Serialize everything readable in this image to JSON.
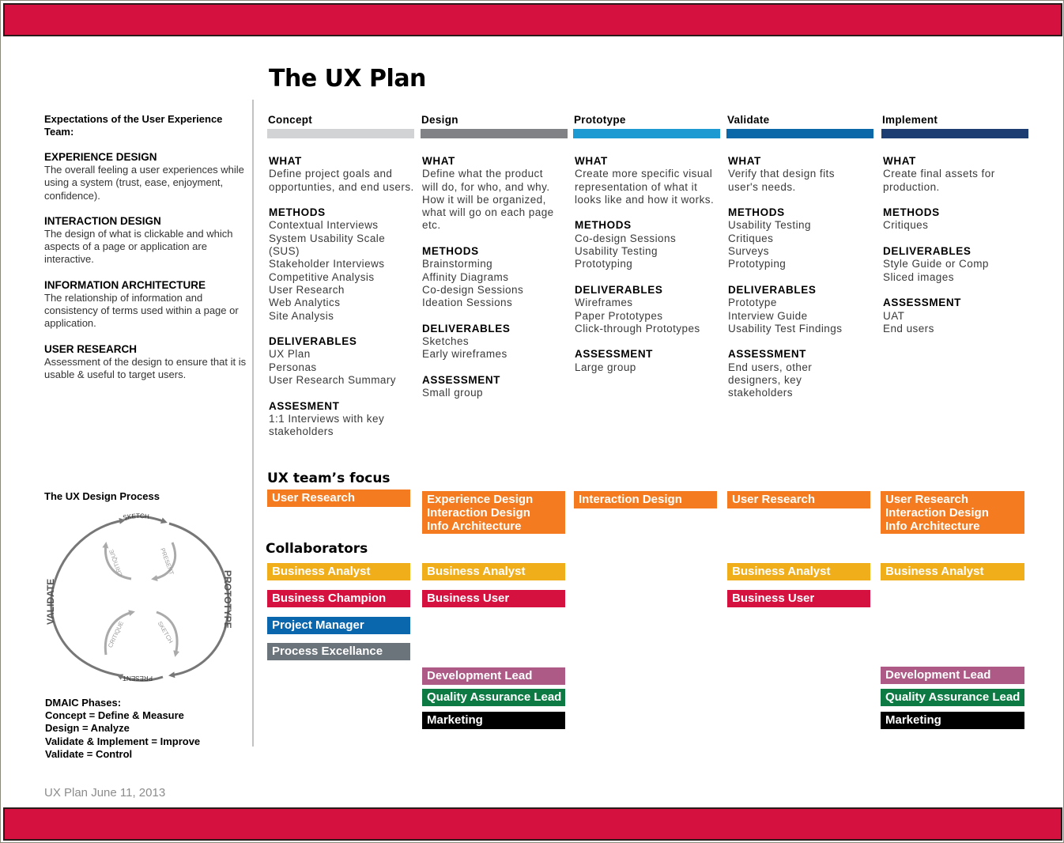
{
  "document": {
    "title": "The UX Plan",
    "footer_note": "UX Plan  June 11, 2013"
  },
  "colors": {
    "band": "#d4113f",
    "focus_orange": "#f47b20",
    "business_analyst": "#f0ae1b",
    "business_red": "#d4113f",
    "project_manager": "#0a66ad",
    "process_gray": "#6b737b",
    "development_lead": "#ad5a87",
    "qa_green": "#0d7a44",
    "marketing": "#000000"
  },
  "left": {
    "intro": "Expectations of the User Experience Team:",
    "definitions": [
      {
        "heading": "EXPERIENCE DESIGN",
        "text": "The overall feeling a user experiences while using a system (trust, ease, enjoyment, confidence)."
      },
      {
        "heading": "INTERACTION DESIGN",
        "text": "The design of what is clickable and which aspects of a page or application are interactive."
      },
      {
        "heading": "INFORMATION ARCHITECTURE",
        "text": "The relationship of information and consistency of terms used within a page or application."
      },
      {
        "heading": "USER RESEARCH",
        "text": "Assessment of the design to ensure that it is usable & useful to target users."
      }
    ],
    "process": {
      "title": "The UX Design Process",
      "outer_left": "VALIDATE",
      "outer_right": "PROTOTYPE",
      "top_label": "SKETCH",
      "bottom_label": "PRESENT",
      "upper_loop": [
        "CRITIQUE",
        "PRESENT"
      ],
      "lower_loop": [
        "CRITIQUE",
        "SKETCH"
      ]
    },
    "dmaic": [
      "DMAIC Phases:",
      "Concept = Define & Measure",
      "Design = Analyze",
      "Validate & Implement = Improve",
      "Validate = Control"
    ]
  },
  "phases": [
    {
      "name": "Concept",
      "bar_color": "#d1d3d5",
      "sections": [
        {
          "heading": "WHAT",
          "items": [
            "Define project goals and",
            "opportunties, and end users."
          ]
        },
        {
          "heading": "METHODS",
          "items": [
            "Contextual Interviews",
            "System Usability Scale",
            "(SUS)",
            "Stakeholder Interviews",
            "Competitive Analysis",
            "User Research",
            "Web Analytics",
            "Site Analysis"
          ]
        },
        {
          "heading": "DELIVERABLES",
          "items": [
            "UX Plan",
            "Personas",
            "User Research Summary"
          ]
        },
        {
          "heading": "ASSESMENT",
          "items": [
            "1:1 Interviews with key",
            "stakeholders"
          ]
        }
      ]
    },
    {
      "name": "Design",
      "bar_color": "#808285",
      "sections": [
        {
          "heading": "WHAT",
          "items": [
            "Define what the product",
            "will do, for who, and why.",
            "How it will be organized,",
            "what will go on each page",
            "etc."
          ]
        },
        {
          "heading": "METHODS",
          "items": [
            "Brainstorming",
            "Affinity Diagrams",
            "Co-design Sessions",
            "Ideation Sessions"
          ]
        },
        {
          "heading": "DELIVERABLES",
          "items": [
            "Sketches",
            "Early wireframes"
          ]
        },
        {
          "heading": "ASSESSMENT",
          "items": [
            "Small group"
          ]
        }
      ]
    },
    {
      "name": "Prototype",
      "bar_color": "#1d9ad1",
      "sections": [
        {
          "heading": "WHAT",
          "items": [
            "Create more specific visual",
            "representation of what it",
            "looks like and how it works."
          ]
        },
        {
          "heading": "METHODS",
          "items": [
            "Co-design Sessions",
            "Usability Testing",
            "Prototyping"
          ]
        },
        {
          "heading": "DELIVERABLES",
          "items": [
            "Wireframes",
            "Paper Prototypes",
            "Click-through Prototypes"
          ]
        },
        {
          "heading": "ASSESSMENT",
          "items": [
            "Large group"
          ]
        }
      ]
    },
    {
      "name": "Validate",
      "bar_color": "#0a67a8",
      "sections": [
        {
          "heading": "WHAT",
          "items": [
            "Verify that design fits",
            "user's needs."
          ]
        },
        {
          "heading": "METHODS",
          "items": [
            "Usability Testing",
            "Critiques",
            "Surveys",
            "Prototyping"
          ]
        },
        {
          "heading": "DELIVERABLES",
          "items": [
            "Prototype",
            "Interview Guide",
            "Usability Test Findings"
          ]
        },
        {
          "heading": "ASSESSMENT",
          "items": [
            "End users, other",
            "designers, key",
            "stakeholders"
          ]
        }
      ]
    },
    {
      "name": "Implement",
      "bar_color": "#1b3d72",
      "sections": [
        {
          "heading": "WHAT",
          "items": [
            "Create final assets for",
            "production."
          ]
        },
        {
          "heading": "METHODS",
          "items": [
            "Critiques"
          ]
        },
        {
          "heading": "DELIVERABLES",
          "items": [
            "Style Guide or Comp",
            "Sliced images"
          ]
        },
        {
          "heading": "ASSESSMENT",
          "items": [
            "UAT",
            "End users"
          ]
        }
      ]
    }
  ],
  "focus": {
    "heading": "UX team’s focus",
    "items": [
      [
        "User  Research"
      ],
      [
        "Experience Design",
        "Interaction Design",
        "Info Architecture"
      ],
      [
        "Interaction Design"
      ],
      [
        "User  Research"
      ],
      [
        "User  Research",
        "Interaction Design",
        "Info Architecture"
      ]
    ]
  },
  "collaborators": {
    "heading": "Collaborators",
    "concept": [
      "Business Analyst",
      "Business Champion",
      "Project Manager",
      "Process Excellance"
    ],
    "design": [
      "Business Analyst",
      "Business User",
      "Development Lead",
      "Quality Assurance Lead",
      "Marketing"
    ],
    "validate": [
      "Business Analyst",
      "Business User"
    ],
    "implement": [
      "Business Analyst",
      "Development Lead",
      "Quality Assurance Lead",
      "Marketing"
    ]
  }
}
